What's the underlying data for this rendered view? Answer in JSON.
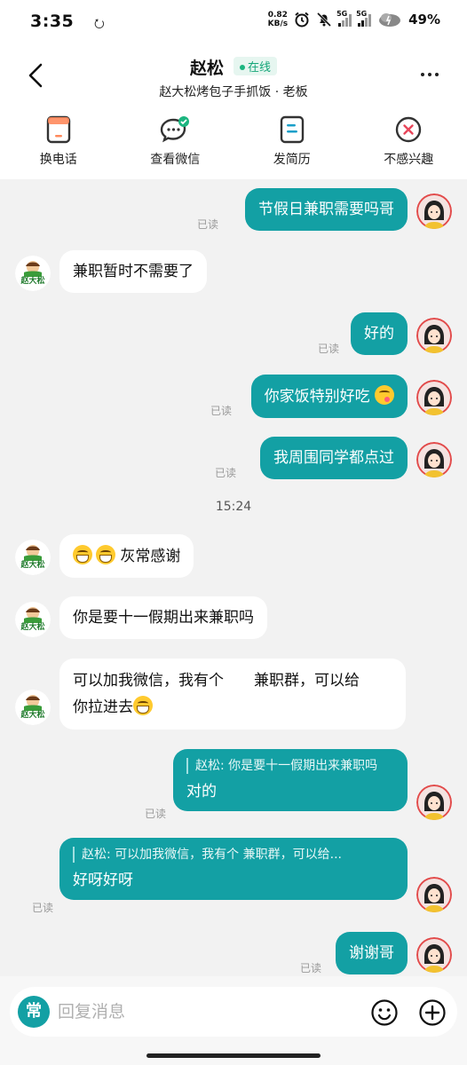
{
  "status_bar": {
    "time": "3:35",
    "net_speed_value": "0.82",
    "net_speed_unit": "KB/s",
    "signal_1": "5G",
    "signal_2": "5G",
    "battery": "49%"
  },
  "header": {
    "name": "赵松",
    "online": "在线",
    "subtitle": "赵大松烤包子手抓饭 · 老板"
  },
  "actions": [
    {
      "label": "换电话",
      "icon": "phone-card-icon"
    },
    {
      "label": "查看微信",
      "icon": "wechat-icon"
    },
    {
      "label": "发简历",
      "icon": "resume-icon"
    },
    {
      "label": "不感兴趣",
      "icon": "not-interested-icon"
    }
  ],
  "chat": {
    "read_label": "已读",
    "timestamp": "15:24",
    "messages": [
      {
        "from": "me",
        "text": "节假日兼职需要吗哥"
      },
      {
        "from": "them",
        "text": "兼职暂时不需要了"
      },
      {
        "from": "me",
        "text": "好的"
      },
      {
        "from": "me",
        "text": "你家饭特别好吃"
      },
      {
        "from": "me",
        "text": "我周围同学都点过"
      },
      {
        "from": "them",
        "text": "灰常感谢"
      },
      {
        "from": "them",
        "text": "你是要十一假期出来兼职吗"
      },
      {
        "from": "them",
        "text_line1": "可以加我微信，我有个",
        "text_line1b": "兼职群，可以给",
        "text_line2": "你拉进去"
      },
      {
        "from": "me",
        "quote": "赵松: 你是要十一假期出来兼职吗",
        "text": "对的"
      },
      {
        "from": "me",
        "quote": "赵松: 可以加我微信，我有个   兼职群，可以给...",
        "text": "好呀好呀"
      },
      {
        "from": "me",
        "text": "谢谢哥"
      }
    ]
  },
  "boss_avatar_text": "赵大松",
  "input": {
    "quick_label": "常",
    "placeholder": "回复消息"
  },
  "colors": {
    "accent": "#13a0a4",
    "online": "#1ab57f",
    "background": "#f2f2f2"
  }
}
